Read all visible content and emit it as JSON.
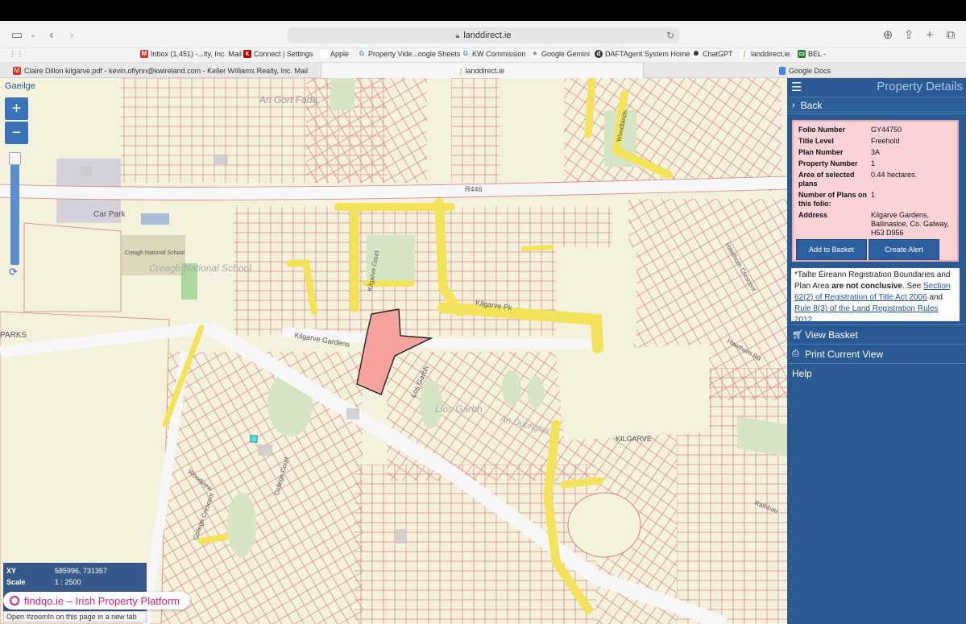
{
  "browser": {
    "url": "landdirect.ie",
    "bookmarks": [
      {
        "label": "Inbox (1,451) -...lty, Inc. Mail",
        "icon": "gmail-icon",
        "color": "#d93025"
      },
      {
        "label": "Connect | Settings",
        "icon": "kw-icon",
        "color": "#b40101"
      },
      {
        "label": "Apple",
        "icon": "apple-icon",
        "color": "#333333"
      },
      {
        "label": "Property Vide...oogle Sheets",
        "icon": "google-icon",
        "color": "#4285f4"
      },
      {
        "label": "KW Commission",
        "icon": "google-icon",
        "color": "#4285f4"
      },
      {
        "label": "Google Gemini",
        "icon": "gemini-icon",
        "color": "#7b6cf0"
      },
      {
        "label": "DAFTAgent System Home",
        "icon": "daft-icon",
        "color": "#333333"
      },
      {
        "label": "ChatGPT",
        "icon": "chatgpt-icon",
        "color": "#333333"
      },
      {
        "label": "landdirect.ie",
        "icon": "landdirect-icon",
        "color": "#c6a25a"
      },
      {
        "label": "BEL -",
        "icon": "bel-icon",
        "color": "#2e7d32"
      }
    ],
    "tabs": [
      {
        "label": "Claire Dillon kilgarve.pdf - kevin.oflynn@kwireland.com - Keller Williams Realty, Inc. Mail",
        "icon": "gmail-icon"
      },
      {
        "label": "landdirect.ie",
        "icon": "landdirect-icon"
      },
      {
        "label": "Google Docs",
        "icon": "docs-icon"
      }
    ]
  },
  "map": {
    "language_link": "Gaeilge",
    "zoom_in": "+",
    "zoom_out": "−",
    "labels": {
      "an_gort_fada": "An Gort Fada",
      "car_park": "Car Park",
      "school_small": "Creagh National School",
      "school_big": "Creagh National School",
      "parks": "PARKS",
      "r446": "R446",
      "kilgarve_court": "Kilgarve Court",
      "kilgarve_pk": "Kilgarve Pk",
      "kilgarve_gardens": "Kilgarve Gardens",
      "los_garbh": "Los Garbh",
      "lios_garbh": "Lios Garbh",
      "an_dubhglas": "An Dubhglas",
      "kilgarve": "KILGARVE",
      "woodlands": "Woodlands",
      "hawthorn_crescent": "Hawthorn Crescent",
      "hawthorn_rd": "Hawthorn Rd",
      "rathbaun": "Rathbau",
      "woodview": "Woodview",
      "college_crescent": "College Crescent",
      "college_court": "College Court"
    },
    "info": {
      "xy_label": "XY",
      "xy_value": "585996, 731357",
      "scale_label": "Scale",
      "scale_value": "1 : 2500"
    },
    "overlay": "findqo.ie – Irish Property Platform",
    "status": "Open #zoomIn on this page in a new tab"
  },
  "sidebar": {
    "title": "Property Details",
    "back": "Back",
    "folio": {
      "rows": [
        {
          "label": "Folio Number",
          "value": "GY44750"
        },
        {
          "label": "Title Level",
          "value": "Freehold"
        },
        {
          "label": "Plan Number",
          "value": "3A"
        },
        {
          "label": "Property Number",
          "value": "1"
        },
        {
          "label": "Area of selected plans",
          "value": "0.44 hectares."
        },
        {
          "label": "Number of Plans on this folio:",
          "value": "1"
        },
        {
          "label": "Address",
          "value": "Kilgarve Gardens, Ballinasloe, Co. Galway, H53 D956"
        }
      ],
      "add_to_basket": "Add to Basket",
      "create_alert": "Create Alert"
    },
    "notice": {
      "p1": "*Tailte Éireann Registration Boundaries and Plan Area ",
      "bold": "are not conclusive",
      "p2": ". See ",
      "link1": "Section 62(2) of Registration of Title Act 2006",
      "p3": " and ",
      "link2": "Rule 8(3) of the Land Registration Rules 2012",
      "p4": "."
    },
    "menu": [
      "View Basket",
      "Print Current View",
      "Help"
    ]
  }
}
